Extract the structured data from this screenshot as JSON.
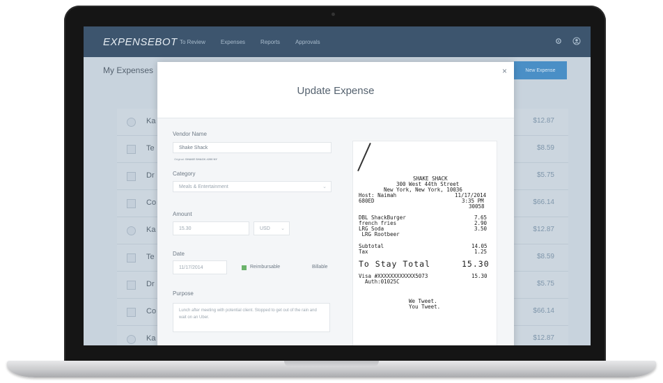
{
  "app": {
    "logo": "EXPENSEBOT",
    "nav": [
      "To Review",
      "Expenses",
      "Reports",
      "Approvals"
    ]
  },
  "page": {
    "title": "My Expenses",
    "new_button": "New Expense"
  },
  "expenses": [
    {
      "name": "Ka",
      "amount": "$12.87",
      "round": true
    },
    {
      "name": "Te",
      "amount": "$8.59",
      "round": false
    },
    {
      "name": "Dr",
      "amount": "$5.75",
      "round": false
    },
    {
      "name": "Co",
      "amount": "$66.14",
      "round": false
    },
    {
      "name": "Ka",
      "amount": "$12.87",
      "round": true
    },
    {
      "name": "Te",
      "amount": "$8.59",
      "round": false
    },
    {
      "name": "Dr",
      "amount": "$5.75",
      "round": false
    },
    {
      "name": "Co",
      "amount": "$66.14",
      "round": false
    },
    {
      "name": "Ka",
      "amount": "$12.87",
      "round": true
    }
  ],
  "modal": {
    "title": "Update Expense",
    "close": "×",
    "vendor_label": "Vendor Name",
    "vendor_value": "Shake Shack",
    "vendor_hint_prefix": "Original:",
    "vendor_hint_value": "SHAKE SHACK #200 NY",
    "category_label": "Category",
    "category_value": "Meals & Entertainment",
    "amount_label": "Amount",
    "amount_value": "15.30",
    "currency_value": "USD",
    "date_label": "Date",
    "date_value": "11/17/2014",
    "reimbursable_label": "Reimbursable",
    "billable_label": "Billable",
    "purpose_label": "Purpose",
    "purpose_value": "Lunch after meeting with potential client. Stopped to get out of the rain and wait on an Uber."
  },
  "receipt": {
    "store": "SHAKE SHACK",
    "address1": "300 West 44th Street",
    "address2": "New York, New York, 10036",
    "host": "Host: Naimah",
    "date": "11/17/2014",
    "code": "680ED",
    "time": "3:35 PM",
    "check": "30058",
    "items": [
      {
        "name": "DBL ShackBurger",
        "price": "7.65"
      },
      {
        "name": "french fries",
        "price": "2.90"
      },
      {
        "name": "LRG Soda",
        "price": "3.50"
      },
      {
        "name": " LRG Rootbeer",
        "price": ""
      }
    ],
    "subtotal_label": "Subtotal",
    "subtotal": "14.05",
    "tax_label": "Tax",
    "tax": "1.25",
    "total_label": "To Stay Total",
    "total": "15.30",
    "card": "Visa #XXXXXXXXXXXX5073",
    "card_amount": "15.30",
    "auth": "  Auth:01025C",
    "footer1": "We Tweet.",
    "footer2": "You Tweet."
  }
}
